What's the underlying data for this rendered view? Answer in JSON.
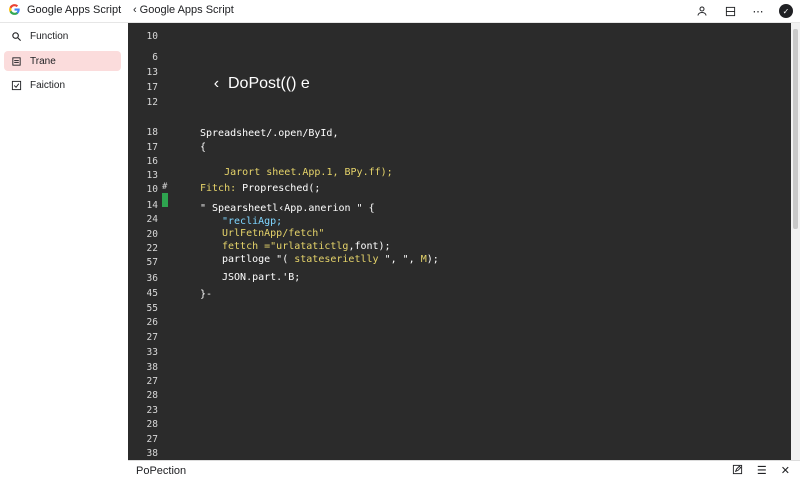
{
  "brand": {
    "title": "Google Apps Script"
  },
  "breadcrumb": {
    "back_icon": "chevron-left-icon",
    "title": "Google Apps Script"
  },
  "top_icons": [
    "person-icon",
    "panel-icon",
    "more-icon",
    "avatar"
  ],
  "sidebar": {
    "items": [
      {
        "label": "Function",
        "icon": "search-icon"
      },
      {
        "label": "Trane",
        "icon": "file-icon",
        "active": true
      },
      {
        "label": "Faiction",
        "icon": "checkbox-icon"
      }
    ]
  },
  "editor": {
    "line_numbers": [
      "10",
      "6",
      "13",
      "17",
      "12",
      "18",
      "17",
      "16",
      "13",
      "10",
      "14",
      "24",
      "20",
      "22",
      "57",
      "36",
      "45",
      "55",
      "26",
      "27",
      "33",
      "38",
      "27",
      "28",
      "23",
      "28",
      "27",
      "38"
    ],
    "func_header": "‹  DoPost(() e",
    "lines": {
      "l1": "Spreadsheet/.open/ById,",
      "l2": "{",
      "l3": "Jarort sheet.App.1, BPy.ff);",
      "l4a": "Fitch:",
      "l4b": " Propresched(;",
      "l5": "\" Spearsheetl‹App.anerion \" {",
      "l6": "\"recliAgp;",
      "l7": "UrlFetnApp/fetch\"",
      "l8a": "fettch",
      "l8b": " =\"urlatatictlg",
      "l8c": ",font);",
      "l9a": "partloge \"( ",
      "l9b": "stateserietlly",
      "l9c": " \", \",",
      "l9d": " M",
      "l9e": ");",
      "l10": "JSON.part.'B;",
      "l11": "}-"
    }
  },
  "bottom_panel": {
    "label": "PoPection",
    "icons": [
      "edit-icon",
      "list-icon",
      "close-icon"
    ]
  },
  "colors": {
    "editor_bg": "#2b2b2b",
    "keyword": "#e6d46a",
    "string": "#7fd6ff",
    "active_item": "#fbdcdc"
  }
}
